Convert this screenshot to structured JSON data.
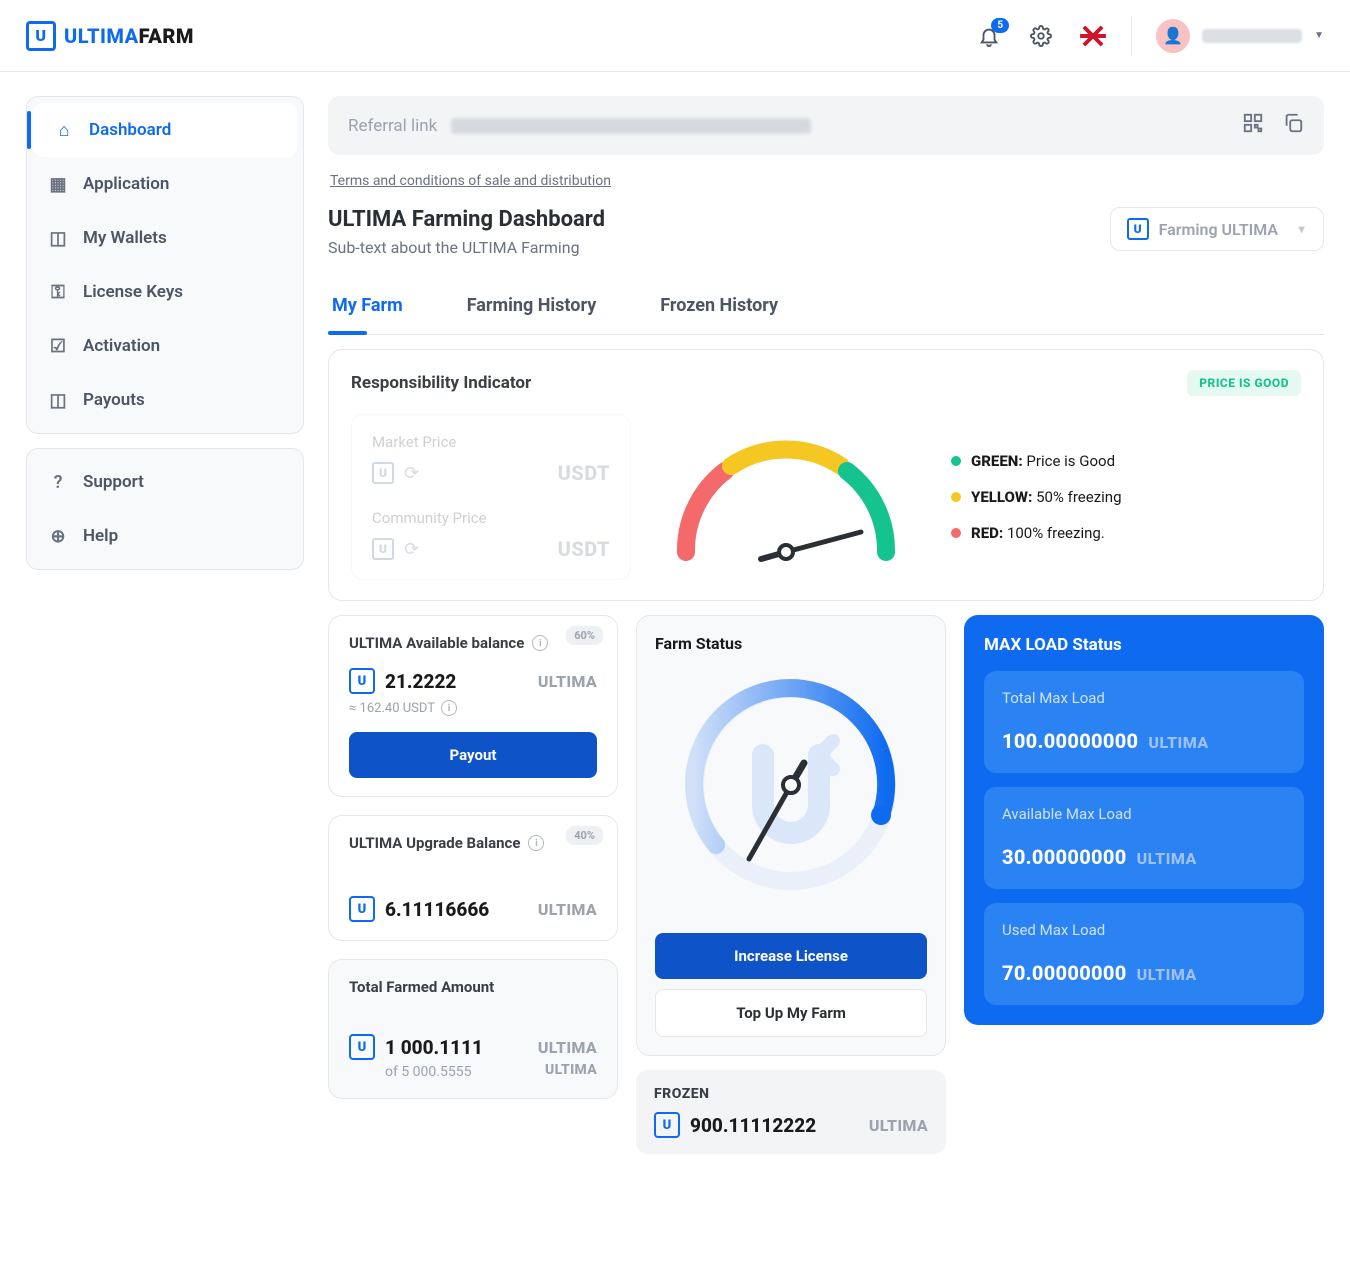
{
  "brand": {
    "logo_u": "U",
    "logo_main": "ULTIMA",
    "logo_sub": "FARM"
  },
  "topbar": {
    "notif_count": "5"
  },
  "sidebar": {
    "group1": [
      {
        "label": "Dashboard"
      },
      {
        "label": "Application"
      },
      {
        "label": "My Wallets"
      },
      {
        "label": "License Keys"
      },
      {
        "label": "Activation"
      },
      {
        "label": "Payouts"
      }
    ],
    "group2": [
      {
        "label": "Support"
      },
      {
        "label": "Help"
      }
    ]
  },
  "referral": {
    "label": "Referral link"
  },
  "terms": "Terms and conditions of sale and distribution",
  "header": {
    "title": "ULTIMA Farming Dashboard",
    "sub": "Sub-text about the ULTIMA Farming",
    "select": "Farming ULTIMA"
  },
  "tabs": [
    "My Farm",
    "Farming History",
    "Frozen History"
  ],
  "resp": {
    "title": "Responsibility Indicator",
    "badge": "PRICE IS GOOD",
    "market_label": "Market Price",
    "community_label": "Community Price",
    "unit": "USDT",
    "legend": {
      "green_k": "GREEN:",
      "green_v": " Price is Good",
      "yellow_k": "YELLOW:",
      "yellow_v": " 50% freezing",
      "red_k": "RED:",
      "red_v": " 100% freezing."
    }
  },
  "avail": {
    "title": "ULTIMA Available balance",
    "pct": "60%",
    "amount": "21.2222",
    "unit": "ULTIMA",
    "approx": "≈ 162.40 USDT",
    "btn": "Payout"
  },
  "upgrade": {
    "title": "ULTIMA Upgrade Balance",
    "pct": "40%",
    "amount": "6.11116666",
    "unit": "ULTIMA"
  },
  "total": {
    "title": "Total Farmed Amount",
    "amount": "1 000.1111",
    "unit": "ULTIMA",
    "of": "of 5 000.5555",
    "of_unit": "ULTIMA"
  },
  "farm_status": {
    "title": "Farm Status",
    "btn1": "Increase License",
    "btn2": "Top Up My Farm",
    "frozen_title": "FROZEN",
    "frozen_amount": "900.11112222",
    "frozen_unit": "ULTIMA"
  },
  "maxload": {
    "title": "MAX LOAD Status",
    "blocks": [
      {
        "label": "Total Max Load",
        "value": "100.00000000",
        "unit": "ULTIMA"
      },
      {
        "label": "Available Max Load",
        "value": "30.00000000",
        "unit": "ULTIMA"
      },
      {
        "label": "Used Max Load",
        "value": "70.00000000",
        "unit": "ULTIMA"
      }
    ]
  }
}
